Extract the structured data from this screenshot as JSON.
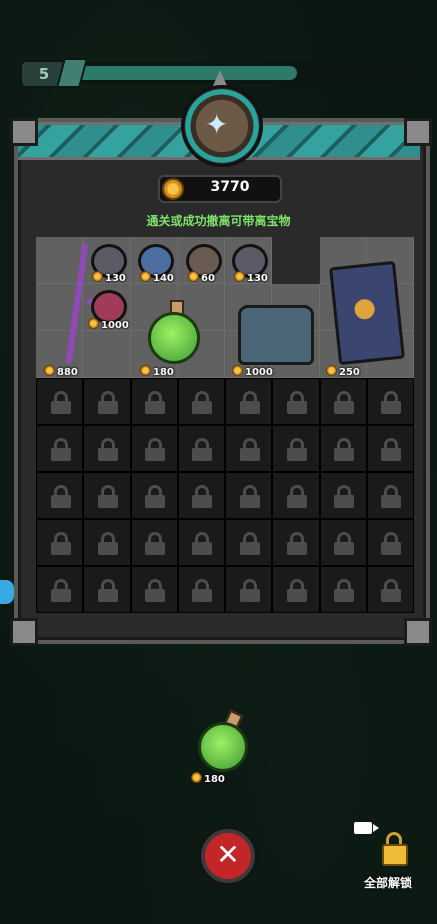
{
  "hud": {
    "level": "5",
    "progress_fraction": 0.66
  },
  "header": {
    "coins": "3770",
    "subtitle": "通关或成功撤离可带离宝物"
  },
  "loot": [
    {
      "name": "purple-branch",
      "price": "880"
    },
    {
      "name": "beetle-gem",
      "price": "130"
    },
    {
      "name": "ring-gem",
      "price": "140"
    },
    {
      "name": "skull-gem",
      "price": "60"
    },
    {
      "name": "beetle-gem-2",
      "price": "130"
    },
    {
      "name": "spiral-gem",
      "price": "1000"
    },
    {
      "name": "green-potion",
      "price": "180"
    },
    {
      "name": "leather-satchel",
      "price": "1000"
    },
    {
      "name": "paw-spellbook",
      "price": "250"
    }
  ],
  "ground_item": {
    "name": "green-potion",
    "price": "180"
  },
  "unlock_all": {
    "label": "全部解锁"
  },
  "colors": {
    "accent_teal": "#2e8f8c",
    "close_red": "#c22626",
    "subtitle_green": "#7de26a",
    "coin_gold": "#f7c34b"
  }
}
